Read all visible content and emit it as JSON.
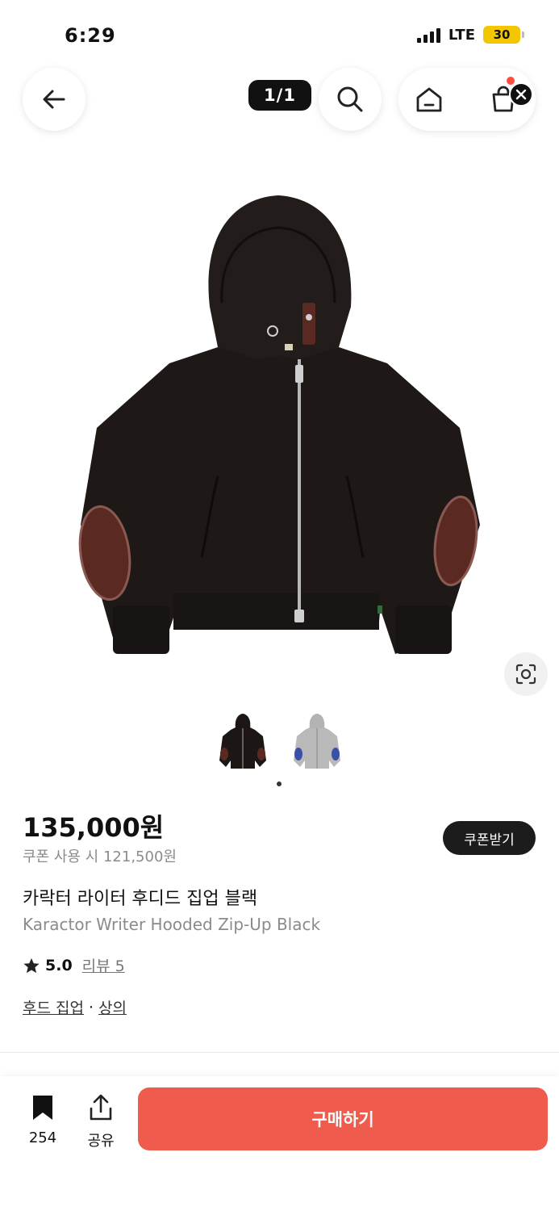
{
  "status_bar": {
    "time": "6:29",
    "network": "LTE",
    "battery": "30"
  },
  "nav": {
    "image_counter": "1/1"
  },
  "product": {
    "price": "135,000원",
    "coupon_price": "쿠폰 사용 시 121,500원",
    "coupon_button": "쿠폰받기",
    "name_ko": "카락터 라이터 후디드 집업 블랙",
    "name_en": "Karactor Writer Hooded Zip-Up Black",
    "rating": "5.0",
    "review_label": "리뷰 5",
    "categories": [
      "후드 집업",
      "상의"
    ],
    "category_separator": "·"
  },
  "gallery": {
    "thumbnails": [
      {
        "icon": "black-hoodie-thumb",
        "color": "#1c1715"
      },
      {
        "icon": "gray-hoodie-thumb",
        "color": "#b9b9b9"
      }
    ]
  },
  "bottom_bar": {
    "bookmark_count": "254",
    "share_label": "공유",
    "buy_label": "구매하기"
  },
  "colors": {
    "accent": "#ef5b4c",
    "dark": "#1c1c1c",
    "hoodie": "#1e1917",
    "patch": "#5a2a22"
  }
}
